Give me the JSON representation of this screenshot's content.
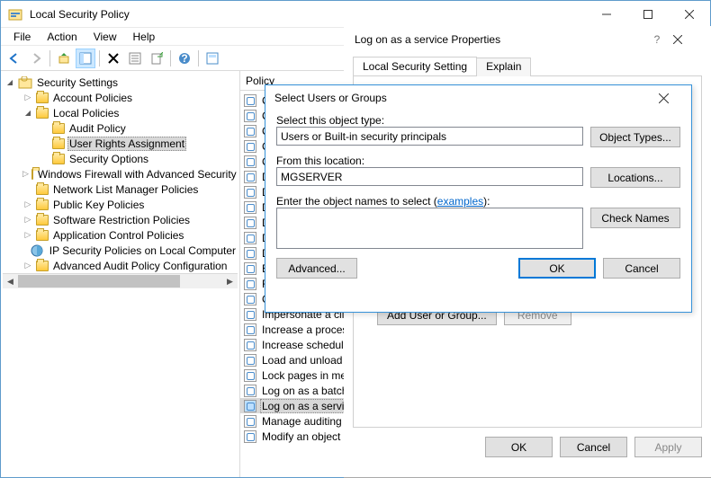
{
  "window": {
    "title": "Local Security Policy"
  },
  "menu": [
    "File",
    "Action",
    "View",
    "Help"
  ],
  "tree": {
    "root": "Security Settings",
    "items": [
      {
        "depth": 1,
        "exp": "closed",
        "label": "Account Policies"
      },
      {
        "depth": 1,
        "exp": "open",
        "label": "Local Policies"
      },
      {
        "depth": 2,
        "exp": "none",
        "label": "Audit Policy"
      },
      {
        "depth": 2,
        "exp": "none",
        "label": "User Rights Assignment",
        "selected": true
      },
      {
        "depth": 2,
        "exp": "none",
        "label": "Security Options"
      },
      {
        "depth": 1,
        "exp": "closed",
        "label": "Windows Firewall with Advanced Security"
      },
      {
        "depth": 1,
        "exp": "none",
        "label": "Network List Manager Policies"
      },
      {
        "depth": 1,
        "exp": "closed",
        "label": "Public Key Policies"
      },
      {
        "depth": 1,
        "exp": "closed",
        "label": "Software Restriction Policies"
      },
      {
        "depth": 1,
        "exp": "closed",
        "label": "Application Control Policies"
      },
      {
        "depth": 1,
        "exp": "none",
        "label": "IP Security Policies on Local Computer",
        "special": "ipsec"
      },
      {
        "depth": 1,
        "exp": "closed",
        "label": "Advanced Audit Policy Configuration"
      }
    ]
  },
  "list": {
    "header": "Policy",
    "rows": [
      "Create a pagefile",
      "Create a token object",
      "Create global objects",
      "Create permanent shared objects",
      "Create symbolic links",
      "Debug programs",
      "Deny access to this computer from the network",
      "Deny log on as a batch job",
      "Deny log on as a service",
      "Deny log on locally",
      "Deny log on through Remote Desktop Services",
      "Enable computer and user accounts to be trusted for delegation",
      "Force shutdown from a remote system",
      "Generate security audits",
      "Impersonate a client after authentication",
      "Increase a process working set",
      "Increase scheduling priority",
      "Load and unload device drivers",
      "Lock pages in memory",
      "Log on as a batch job",
      "Log on as a service",
      "Manage auditing and security log",
      "Modify an object label"
    ],
    "selected_index": 20
  },
  "props": {
    "title": "Log on as a service Properties",
    "tabs": [
      "Local Security Setting",
      "Explain"
    ],
    "buttons": {
      "add": "Add User or Group...",
      "remove": "Remove",
      "ok": "OK",
      "cancel": "Cancel",
      "apply": "Apply"
    }
  },
  "select_dialog": {
    "title": "Select Users or Groups",
    "object_type_label": "Select this object type:",
    "object_type_value": "Users or Built-in security principals",
    "object_types_btn": "Object Types...",
    "location_label": "From this location:",
    "location_value": "MGSERVER",
    "locations_btn": "Locations...",
    "names_label_prefix": "Enter the object names to select (",
    "names_label_link": "examples",
    "names_label_suffix": "):",
    "check_names_btn": "Check Names",
    "advanced_btn": "Advanced...",
    "ok_btn": "OK",
    "cancel_btn": "Cancel"
  }
}
